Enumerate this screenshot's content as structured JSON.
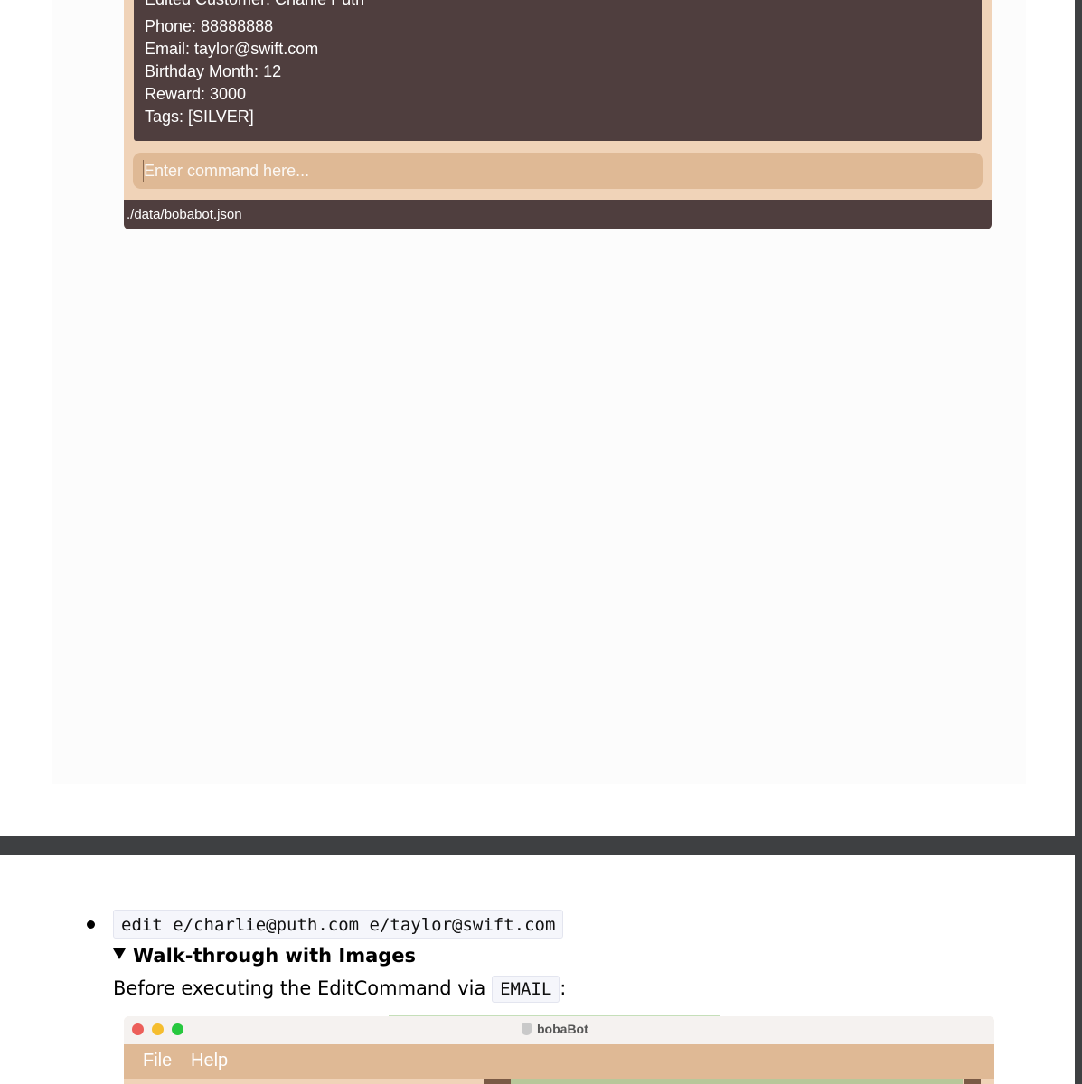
{
  "app_result": {
    "partial_line": "Edited Customer: Charlie Puth",
    "lines": [
      "Phone: 88888888",
      "Email: taylor@swift.com",
      "Birthday Month: 12",
      "Reward: 3000",
      "Tags: [SILVER]"
    ]
  },
  "command_box": {
    "placeholder": "Enter command here..."
  },
  "status_bar": {
    "path": "./data/bobabot.json"
  },
  "doc": {
    "command": "edit e/charlie@puth.com e/taylor@swift.com",
    "details_summary": "Walk-through with Images",
    "before_text": "Before executing the EditCommand via",
    "code_email": "EMAIL",
    "after_colon": ":"
  },
  "app2": {
    "title": "bobaBot",
    "menu": [
      "File",
      "Help"
    ]
  },
  "colors": {
    "dark_brown": "#4f3e3e",
    "tan": "#dfb995",
    "light_tan": "#f0d3b8",
    "red": "#ec5f5a",
    "yellow": "#f5bd2e",
    "green": "#27c83f"
  }
}
